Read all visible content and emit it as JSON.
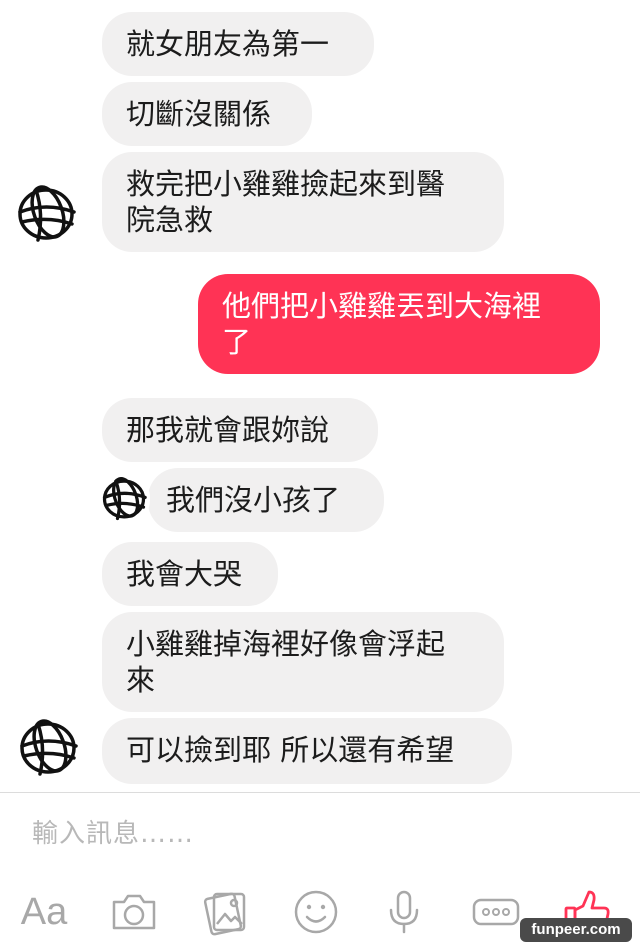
{
  "messages": [
    {
      "side": "in",
      "text": "就女朋友為第一"
    },
    {
      "side": "in",
      "text": "切斷沒關係"
    },
    {
      "side": "in",
      "text": "救完把小雞雞撿起來到醫\n院急救"
    },
    {
      "side": "out",
      "text": "他們把小雞雞丟到大海裡\n了"
    },
    {
      "side": "in",
      "text": "那我就會跟妳說"
    },
    {
      "side": "in",
      "text": "我們沒小孩了"
    },
    {
      "side": "in",
      "text": "我會大哭"
    },
    {
      "side": "in",
      "text": "小雞雞掉海裡好像會浮起\n來"
    },
    {
      "side": "in",
      "text": "可以撿到耶 所以還有希望"
    }
  ],
  "composer": {
    "placeholder": "輸入訊息……"
  },
  "toolbar": {
    "text_button": "Aa",
    "icons": [
      "camera-icon",
      "gallery-icon",
      "emoji-icon",
      "microphone-icon",
      "more-icon",
      "thumbs-up-icon"
    ]
  },
  "watermark": "funpeer.com",
  "colors": {
    "outgoing_bubble": "#ff3355",
    "incoming_bubble": "#f1f0f0",
    "like_icon": "#ff3355",
    "toolbar_icons": "#a8a8a8"
  }
}
